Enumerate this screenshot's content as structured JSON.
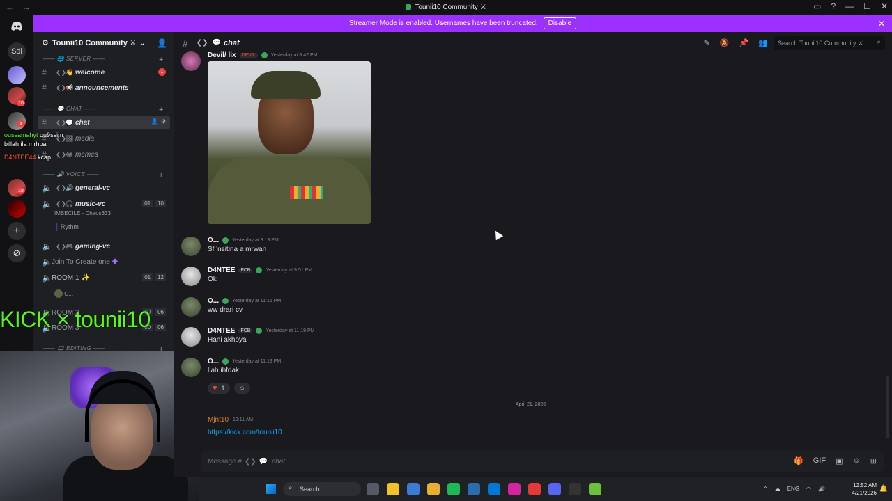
{
  "window": {
    "title": "Tounii10 Community ⚔",
    "nav_back": "←",
    "nav_forward": "→",
    "controls": [
      "▭",
      "?",
      "—",
      "☐",
      "✕"
    ]
  },
  "banner": {
    "text": "Streamer Mode is enabled. Usernames have been truncated.",
    "button": "Disable",
    "close": "✕"
  },
  "rail": {
    "home_icon": "discord-icon",
    "server_label": "Sdl",
    "badges": [
      "10",
      "4",
      "18"
    ],
    "add": "+",
    "explore": "⊘"
  },
  "server": {
    "name": "Tounii10 Community ⚔",
    "chevron": "⌄",
    "categories": {
      "server": "SERVER",
      "chat": "CHAT",
      "voice": "VOICE",
      "editing": "EDITING"
    },
    "channels": {
      "welcome": "welcome",
      "welcome_badge": "1",
      "announcements": "announcements",
      "chat": "chat",
      "media": "media",
      "memes": "memes",
      "general_vc": "general-vc",
      "music_vc": "music-vc",
      "music_vc_counts": [
        "01",
        "10"
      ],
      "music_user": "IMBECILE - Chaos333",
      "rythm": "Rythm",
      "gaming_vc": "gaming-vc",
      "join_to_create": "Join To Create one",
      "room1": "ROOM 1",
      "room1_counts": [
        "01",
        "12"
      ],
      "room1_user": "O...",
      "room2": "ROOM 2",
      "room3": "ROOM 3",
      "room_counts": [
        "00",
        "06"
      ]
    }
  },
  "overlay": {
    "kick": "KICK × tounii10",
    "chat_lines": [
      {
        "user": "oussamahyt",
        "msg": "ou9ssim"
      },
      {
        "user": "",
        "msg": "billah ila mrhba"
      },
      {
        "user": "D4NTEE44",
        "msg": "kcap"
      }
    ]
  },
  "channel_header": {
    "name": "chat",
    "search_placeholder": "Search Tounii10 Community ⚔"
  },
  "messages": {
    "first_user": "Devil/ lix",
    "first_tag": "DEVIL",
    "first_time": "Yesterday at 8:47 PM",
    "list": [
      {
        "user": "O...",
        "time": "Yesterday at 9:13 PM",
        "text": "Sf 'nsitina a mrwan"
      },
      {
        "user": "D4NTEE",
        "tag": "FCB",
        "time": "Yesterday at 9:51 PM",
        "text": "Ok"
      },
      {
        "user": "O...",
        "time": "Yesterday at 11:16 PM",
        "text": "ww drari cv"
      },
      {
        "user": "D4NTEE",
        "tag": "FCB",
        "time": "Yesterday at 11:19 PM",
        "text": "Hani akhoya"
      },
      {
        "user": "O...",
        "time": "Yesterday at 11:19 PM",
        "text": "llah ihfdak"
      }
    ],
    "reaction_count": "1",
    "date_divider": "April 21, 2026",
    "last_user": "Mjnt10",
    "last_time": "12:11 AM",
    "last_link": "https://kick.com/tounii10"
  },
  "composer": {
    "placeholder": "Message #",
    "channel": "chat"
  },
  "taskbar": {
    "search": "Search",
    "lang": "ENG",
    "time": "12:52 AM",
    "date": "4/21/2026"
  }
}
